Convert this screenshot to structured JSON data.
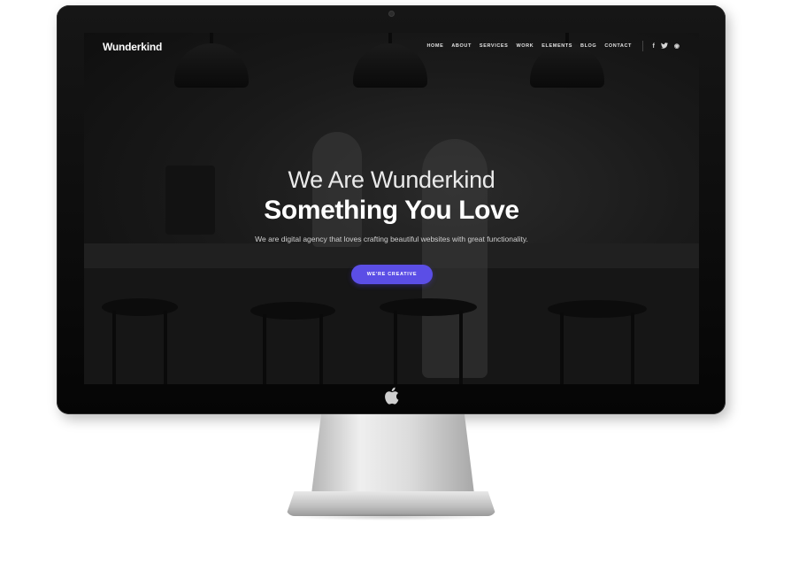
{
  "site": {
    "logo": "Wunderkind",
    "nav": [
      "HOME",
      "ABOUT",
      "SERVICES",
      "WORK",
      "ELEMENTS",
      "BLOG",
      "CONTACT"
    ],
    "social": [
      {
        "icon": "facebook-icon",
        "glyph": "f"
      },
      {
        "icon": "twitter-icon",
        "glyph": "t"
      },
      {
        "icon": "dribbble-icon",
        "glyph": "◉"
      }
    ]
  },
  "hero": {
    "subtitle": "We Are Wunderkind",
    "title": "Something You Love",
    "description": "We are digital agency that loves crafting beautiful websites with great functionality.",
    "cta_label": "WE'RE CREATIVE"
  },
  "colors": {
    "accent": "#5b4ee6",
    "screen_bg": "#1a1a1a",
    "monitor_bezel": "#0a0a0a"
  }
}
